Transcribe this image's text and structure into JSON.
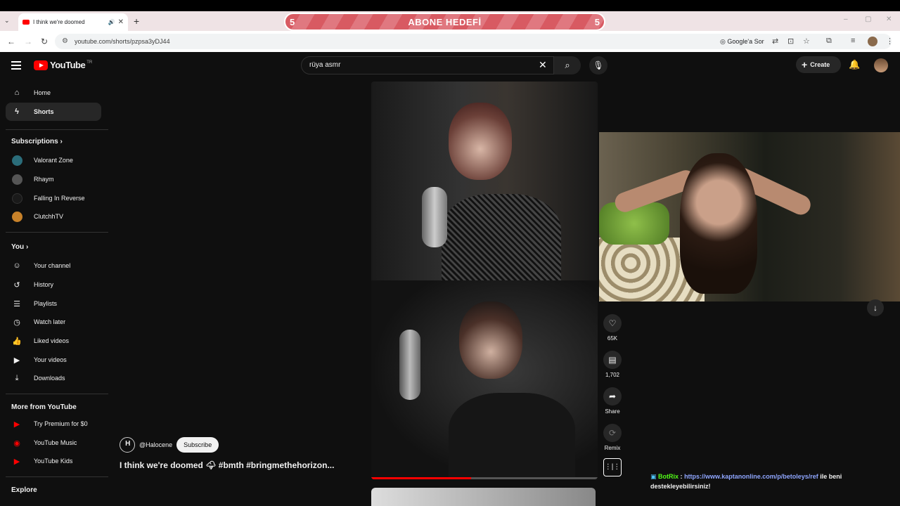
{
  "browser": {
    "tab_title": "I think we're doomed",
    "url": "youtube.com/shorts/pzpsa3yDJ44",
    "google_label": "Google'a Sor"
  },
  "goal": {
    "left_count": "5",
    "label": "ABONE HEDEFİ",
    "right_count": "5"
  },
  "youtube": {
    "logo": "YouTube",
    "region": "TR",
    "search_value": "rüya asmr",
    "create_label": "Create"
  },
  "sidebar": {
    "main": [
      {
        "label": "Home",
        "icon": "home-icon"
      },
      {
        "label": "Shorts",
        "icon": "shorts-icon"
      }
    ],
    "subscriptions_title": "Subscriptions",
    "subscriptions": [
      {
        "label": "Valorant Zone",
        "color": "#2b6d7a"
      },
      {
        "label": "Rhaym",
        "color": "#555555"
      },
      {
        "label": "Falling In Reverse",
        "color": "#1a1a1a"
      },
      {
        "label": "ClutchhTV",
        "color": "#c8822a"
      }
    ],
    "you_title": "You",
    "you": [
      {
        "label": "Your channel",
        "icon": "channel-icon"
      },
      {
        "label": "History",
        "icon": "history-icon"
      },
      {
        "label": "Playlists",
        "icon": "playlists-icon"
      },
      {
        "label": "Watch later",
        "icon": "watch-later-icon"
      },
      {
        "label": "Liked videos",
        "icon": "like-icon"
      },
      {
        "label": "Your videos",
        "icon": "your-videos-icon"
      },
      {
        "label": "Downloads",
        "icon": "download-icon"
      }
    ],
    "more_title": "More from YouTube",
    "more": [
      {
        "label": "Try Premium for $0"
      },
      {
        "label": "YouTube Music"
      },
      {
        "label": "YouTube Kids"
      }
    ],
    "explore_title": "Explore"
  },
  "short": {
    "channel": "@Halocene",
    "subscribe_label": "Subscribe",
    "title": "I think we're doomed 🌩 #bmth #bringmethehorizon...",
    "progress": 0.44,
    "likes": "65K",
    "comments": "1,702",
    "share_label": "Share",
    "remix_label": "Remix"
  },
  "chat": {
    "user": "BotRix",
    "link": "https://www.kaptanonline.com/p/betoleys/ref",
    "text_after": "ile beni destekleyebilirsiniz!"
  }
}
